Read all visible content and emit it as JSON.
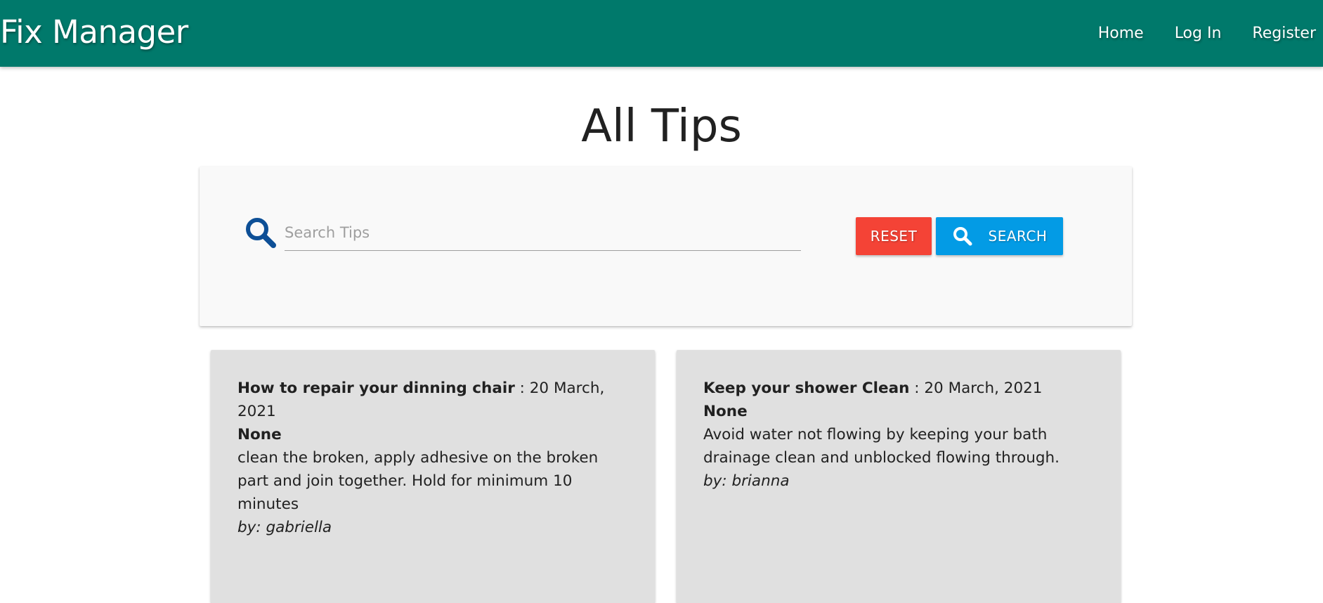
{
  "navbar": {
    "brand": "Fix Manager",
    "links": [
      {
        "label": "Home"
      },
      {
        "label": "Log In"
      },
      {
        "label": "Register"
      }
    ]
  },
  "page": {
    "title": "All Tips"
  },
  "search": {
    "placeholder": "Search Tips",
    "value": "",
    "reset_label": "RESET",
    "search_label": "SEARCH",
    "icon": "search-icon",
    "icon_color": "#0d4f96"
  },
  "colors": {
    "navbar": "#00796b",
    "reset": "#f44336",
    "search": "#039be5",
    "card": "#e0e0e0"
  },
  "tips": [
    {
      "title": "How to repair your dinning chair",
      "separator": " : ",
      "date": "20 March, 2021",
      "category": "None",
      "body": "clean the broken, apply adhesive on the broken part and join together. Hold for minimum 10 minutes",
      "author": "by: gabriella"
    },
    {
      "title": "Keep your shower Clean",
      "separator": " : ",
      "date": "20 March, 2021",
      "category": "None",
      "body": "Avoid water not flowing by keeping your bath drainage clean and unblocked flowing through.",
      "author": "by: brianna"
    }
  ]
}
